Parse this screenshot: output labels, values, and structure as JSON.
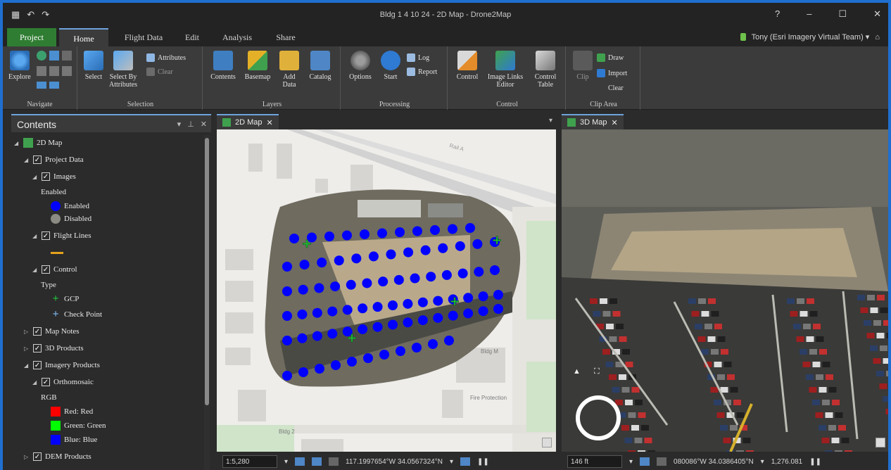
{
  "window": {
    "title": "Bldg 1 4 10 24 - 2D Map - Drone2Map"
  },
  "ribbon_tabs": [
    "Project",
    "Home",
    "Flight Data",
    "Edit",
    "Analysis",
    "Share"
  ],
  "user": {
    "label": "Tony (Esri Imagery Virtual Team) ▾"
  },
  "ribbon": {
    "navigate": {
      "explore": "Explore",
      "label": "Navigate"
    },
    "selection": {
      "select": "Select",
      "select_by_attr": "Select By Attributes",
      "attributes": "Attributes",
      "clear": "Clear",
      "label": "Selection"
    },
    "layers": {
      "contents": "Contents",
      "basemap": "Basemap",
      "add_data": "Add Data",
      "catalog": "Catalog",
      "label": "Layers"
    },
    "processing": {
      "options": "Options",
      "start": "Start",
      "log": "Log",
      "report": "Report",
      "label": "Processing"
    },
    "control": {
      "control": "Control",
      "image_links_editor": "Image Links Editor",
      "control_table": "Control Table",
      "label": "Control"
    },
    "clip_area": {
      "clip": "Clip",
      "draw": "Draw",
      "import": "Import",
      "clear": "Clear",
      "label": "Clip Area"
    }
  },
  "contents": {
    "title": "Contents",
    "items": [
      {
        "label": "2D Map"
      },
      {
        "label": "Project Data"
      },
      {
        "label": "Images"
      },
      {
        "label": "Enabled"
      },
      {
        "label": "Enabled"
      },
      {
        "label": "Disabled"
      },
      {
        "label": "Flight Lines"
      },
      {
        "label": "Control"
      },
      {
        "label": "Type"
      },
      {
        "label": "GCP"
      },
      {
        "label": "Check Point"
      },
      {
        "label": "Map Notes"
      },
      {
        "label": "3D Products"
      },
      {
        "label": "Imagery Products"
      },
      {
        "label": "Orthomosaic"
      },
      {
        "label": "RGB"
      },
      {
        "label": "Red:  Red"
      },
      {
        "label": "Green: Green"
      },
      {
        "label": "Blue:  Blue"
      },
      {
        "label": "DEM Products"
      }
    ]
  },
  "views": {
    "map2d": {
      "tab": "2D Map",
      "scale": "1:5,280",
      "coords": "117.1997654°W 34.0567324°N"
    },
    "map3d": {
      "tab": "3D Map",
      "scale": "146 ft",
      "coords": "080086°W 34.0386405°N",
      "scale2": "1,276.081"
    }
  },
  "map_labels": {
    "rail": "Rail A",
    "bldg": "Bldg M",
    "bldg2": "Bldg 2",
    "fire": "Fire Protection"
  },
  "colors": {
    "accent": "#6ea3dc",
    "project_tab": "#2f7d32",
    "image_point": "#0000ff",
    "gcp": "#21c23a"
  },
  "icons": {
    "user_status": "lock-icon",
    "help": "help-icon"
  }
}
